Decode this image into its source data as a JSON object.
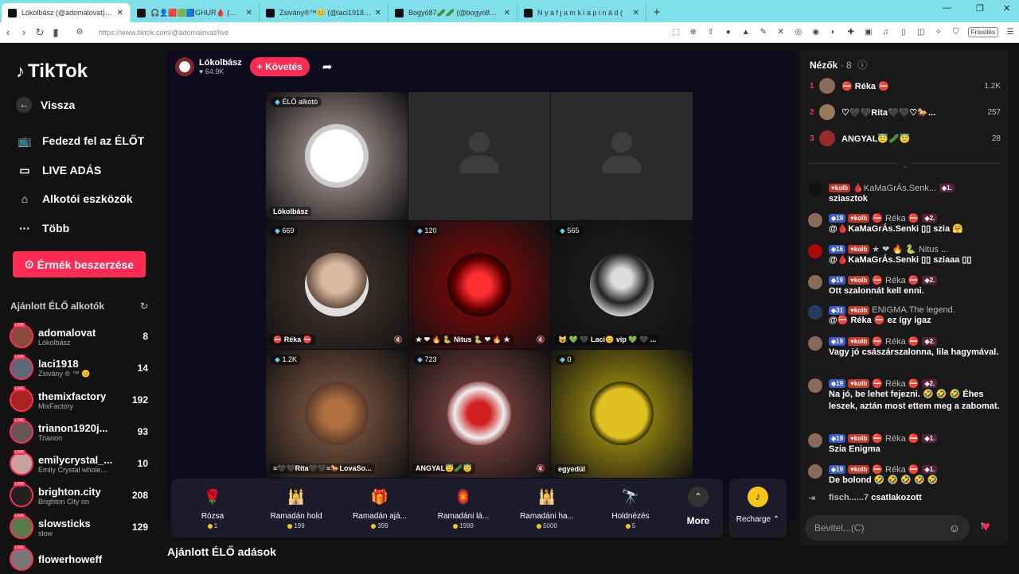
{
  "browser": {
    "tabs": [
      {
        "title": "Lókolbász (@adomalovat) ÉLŐ a",
        "active": true
      },
      {
        "title": "🎧👤🟥🟩🟦GHUR🩸 (@gabor",
        "active": false
      },
      {
        "title": "Zsivány®™😊 (@laci1918) ÉLŐ adás",
        "active": false
      },
      {
        "title": "Bogyó87🥒🥒 (@bogyo87__) ÉLŐ a",
        "active": false
      },
      {
        "title": "N y a f j a m k i a p i n á d (",
        "active": false
      }
    ],
    "url": "https://www.tiktok.com/@adomalovat/live",
    "refresh_label": "Frissítés"
  },
  "sidebar": {
    "logo": "TikTok",
    "nav": [
      {
        "label": "Vissza",
        "icon": "back-arrow-icon"
      },
      {
        "label": "Fedezd fel az ÉLŐT",
        "icon": "tv-icon"
      },
      {
        "label": "LIVE ADÁS",
        "icon": "video-camera-icon"
      },
      {
        "label": "Alkotói eszközök",
        "icon": "lightbulb-icon"
      },
      {
        "label": "Több",
        "icon": "more-dots-icon"
      }
    ],
    "coins_button": "Érmék beszerzése",
    "recommended_title": "Ajánlott ÉLŐ alkotók",
    "creators": [
      {
        "name": "adomalovat",
        "sub": "Lókolbász",
        "count": "8",
        "color": "#8b4a3a"
      },
      {
        "name": "laci1918",
        "sub": "Zsivány ® ™ 😊",
        "count": "14",
        "color": "#5a6a7a"
      },
      {
        "name": "themixfactory",
        "sub": "MixFactory",
        "count": "192",
        "color": "#aa2222"
      },
      {
        "name": "trianon1920j...",
        "sub": "Trianon",
        "count": "93",
        "color": "#665555"
      },
      {
        "name": "emilycrystal_...",
        "sub": "Emily Crystal whole...",
        "count": "10",
        "color": "#c9a0a0"
      },
      {
        "name": "brighton.city",
        "sub": "Brighton City on",
        "count": "208",
        "color": "#222222"
      },
      {
        "name": "slowsticks",
        "sub": "slow",
        "count": "129",
        "color": "#5a7a4a"
      },
      {
        "name": "flowerhoweff",
        "sub": "",
        "count": "",
        "color": "#777777"
      }
    ]
  },
  "host": {
    "name": "Lókolbász",
    "likes": "64.9K",
    "follow_label": "+ Követés"
  },
  "grid": [
    {
      "badge": "ÉLŐ alkotó",
      "label": "Lókolbász",
      "mic_muted": false,
      "type": "host",
      "bg": "#8a7a7a"
    },
    {
      "badge": "",
      "label": "",
      "mic_muted": false,
      "type": "empty",
      "bg": "#2b2b2b"
    },
    {
      "badge": "",
      "label": "",
      "mic_muted": false,
      "type": "empty",
      "bg": "#2b2b2b"
    },
    {
      "badge": "669",
      "label": "⛔ Réka ⛔",
      "mic_muted": true,
      "type": "person",
      "bg": "#3a2e2a"
    },
    {
      "badge": "120",
      "label": "★ ❤ 🔥 🐍 Nitus 🐍 ❤ 🔥 ★",
      "mic_muted": true,
      "type": "heart",
      "bg": "#6a0a0a"
    },
    {
      "badge": "565",
      "label": "😺 💚 🖤 Laci😊 vip 💚 🖤 ...",
      "mic_muted": false,
      "type": "bw",
      "bg": "#1a1a1a"
    },
    {
      "badge": "1.2K",
      "label": "≡🖤🖤Rita🖤🖤≡🐎LovaSo...",
      "mic_muted": false,
      "type": "horse",
      "bg": "#6a4a3a"
    },
    {
      "badge": "723",
      "label": "ANGYAL😇🥒😇",
      "mic_muted": true,
      "type": "angel",
      "bg": "#6a3a3a"
    },
    {
      "badge": "0",
      "label": "egyedül",
      "mic_muted": false,
      "type": "smiley",
      "bg": "#8a7a10"
    }
  ],
  "gifts": [
    {
      "name": "Rózsa",
      "price": "1",
      "icon": "rose-icon",
      "glyph": "🌹"
    },
    {
      "name": "Ramadán hold",
      "price": "199",
      "icon": "moon-icon",
      "glyph": "🕌"
    },
    {
      "name": "Ramadán ajá...",
      "price": "399",
      "icon": "gift-box-icon",
      "glyph": "🎁"
    },
    {
      "name": "Ramadáni lá...",
      "price": "1999",
      "icon": "lantern-icon",
      "glyph": "🏮"
    },
    {
      "name": "Ramadáni ha...",
      "price": "5000",
      "icon": "mosque-icon",
      "glyph": "🕌"
    },
    {
      "name": "Holdnézés",
      "price": "5",
      "icon": "telescope-icon",
      "glyph": "🔭"
    }
  ],
  "gifts_more": "More",
  "recharge_label": "Recharge",
  "bottom_title": "Ajánlott ÉLŐ adások",
  "viewers": {
    "title": "Nézők",
    "count": "8",
    "list": [
      {
        "rank": "1",
        "name": "⛔ Réka ⛔",
        "score": "1.2K",
        "color": "#8a6a5a"
      },
      {
        "rank": "2",
        "name": "♡🖤🖤Rita🖤🖤♡🐎...",
        "score": "257",
        "color": "#9a7a5a"
      },
      {
        "rank": "3",
        "name": "ANGYAL😇🥒😇",
        "score": "28",
        "color": "#9a2a2a"
      }
    ]
  },
  "messages": [
    {
      "badges": [
        "kolb"
      ],
      "level": "",
      "fan": "1.",
      "user": "🩸KaMaGrÁs.Senk...",
      "text": "sziasztok",
      "color": "#111"
    },
    {
      "badges": [
        "kolb"
      ],
      "level": "19",
      "fan": "2.",
      "user": "⛔ Réka ⛔",
      "text": "@🩸KaMaGrÁs.Senki ▯▯ szia 🤗",
      "color": "#8a6a5a"
    },
    {
      "badges": [
        "kolb"
      ],
      "level": "16",
      "fan": "",
      "user": "★ ❤ 🔥 🐍 Nitus ...",
      "text": "@🩸KaMaGrÁs.Senki ▯▯ sziaaa ▯▯",
      "color": "#aa0a0a"
    },
    {
      "badges": [
        "kolb"
      ],
      "level": "19",
      "fan": "2.",
      "user": "⛔ Réka ⛔",
      "text": "Ott szalonnát kell enni.",
      "color": "#8a6a5a"
    },
    {
      "badges": [
        "kolb"
      ],
      "level": "31",
      "fan": "",
      "user": "ENIGMA.The legend.",
      "text": "@⛔ Réka ⛔ ez így igaz",
      "color": "#2a3a5a"
    },
    {
      "badges": [
        "kolb"
      ],
      "level": "19",
      "fan": "2.",
      "user": "⛔ Réka ⛔",
      "text": "Vagy jó császárszalonna, lila hagymával.",
      "color": "#8a6a5a"
    },
    {
      "badges": [
        "kolb"
      ],
      "level": "19",
      "fan": "2.",
      "user": "⛔ Réka ⛔",
      "text": "Na jó, be lehet fejezni. 🤣 🤣 🤣 Éhes leszek, aztán most ettem meg a zabomat.",
      "color": "#8a6a5a"
    },
    {
      "badges": [
        "kolb"
      ],
      "level": "19",
      "fan": "1.",
      "user": "⛔ Réka ⛔",
      "text": "Szia Enigma",
      "color": "#8a6a5a"
    },
    {
      "badges": [
        "kolb"
      ],
      "level": "19",
      "fan": "1.",
      "user": "⛔ Réka ⛔",
      "text": "De bolond 🤣 🤣 🤣 🤣 🤣",
      "color": "#8a6a5a"
    }
  ],
  "join_notice": {
    "user": "fisch......7",
    "text": "csatlakozott"
  },
  "chat_input": {
    "placeholder": "Bevitel...(C)"
  },
  "colors": {
    "accent": "#fe2c55",
    "coin": "#f5c518",
    "tabbar": "#7fe0ea"
  }
}
